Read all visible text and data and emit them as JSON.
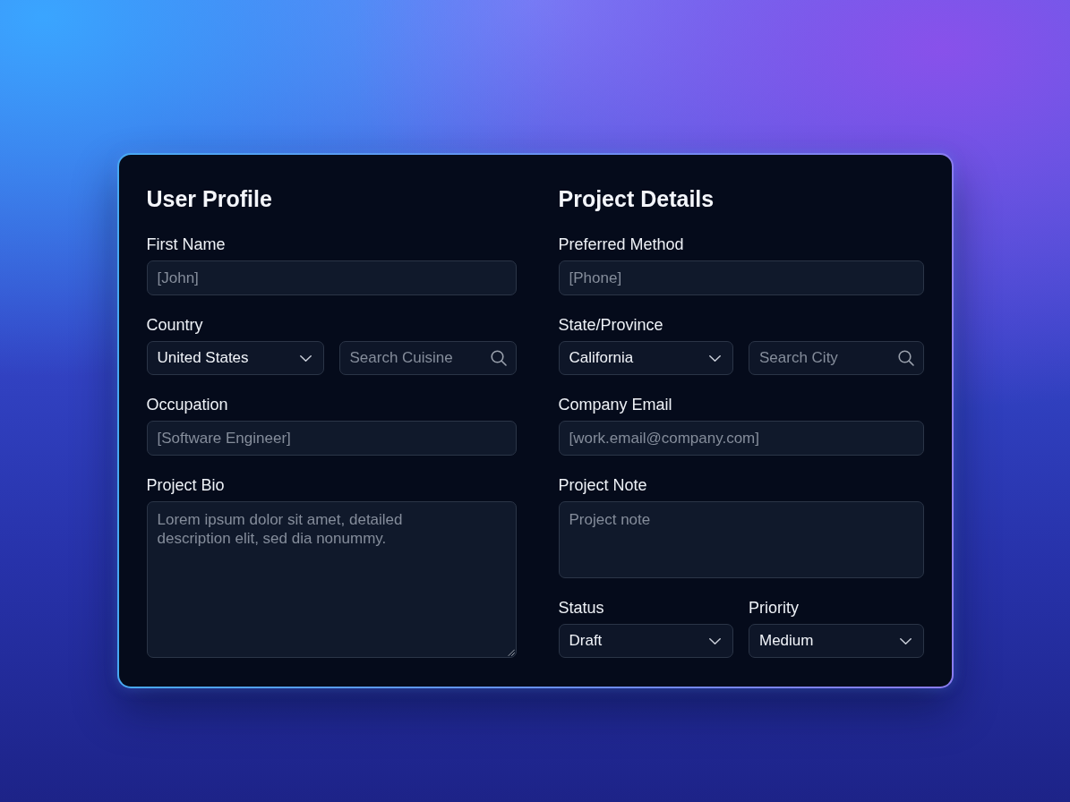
{
  "sections": [
    {
      "title": "User Profile",
      "fields": [
        {
          "kind": "text",
          "label": "First Name",
          "placeholder": "[John]"
        },
        {
          "kind": "select_search",
          "label": "Country",
          "select": {
            "value": "United States"
          },
          "search": {
            "placeholder": "Search Cuisine"
          }
        },
        {
          "kind": "text",
          "label": "Occupation",
          "placeholder": "[Software Engineer]"
        },
        {
          "kind": "textarea",
          "label": "Project Bio",
          "placeholder": "Lorem ipsum dolor sit amet, detailed\ndescription elit, sed dia nonummy.",
          "resizable": true
        }
      ]
    },
    {
      "title": "Project Details",
      "fields": [
        {
          "kind": "text",
          "label": "Preferred Method",
          "placeholder": "[Phone]"
        },
        {
          "kind": "select_search",
          "label": "State/Province",
          "select": {
            "value": "California"
          },
          "search": {
            "placeholder": "Search City"
          }
        },
        {
          "kind": "text",
          "label": "Company Email",
          "placeholder": "[work.email@company.com]"
        },
        {
          "kind": "textarea",
          "label": "Project Note",
          "placeholder": "Project note",
          "resizable": false
        },
        {
          "kind": "select_row",
          "items": [
            {
              "label": "Status",
              "value": "Draft"
            },
            {
              "label": "Priority",
              "value": "Medium"
            }
          ]
        }
      ]
    }
  ]
}
